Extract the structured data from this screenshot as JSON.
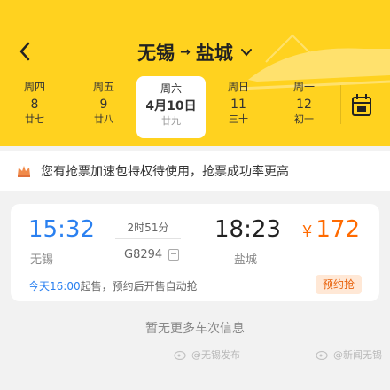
{
  "header": {
    "from": "无锡",
    "to": "盐城",
    "arrow": "→"
  },
  "dates": [
    {
      "weekday": "周四",
      "day": "8",
      "lunar": "廿七"
    },
    {
      "weekday": "周五",
      "day": "9",
      "lunar": "廿八"
    },
    {
      "weekday": "周六",
      "day": "4月10日",
      "lunar": "廿九",
      "selected": true
    },
    {
      "weekday": "周日",
      "day": "11",
      "lunar": "三十"
    },
    {
      "weekday": "周一",
      "day": "12",
      "lunar": "初一"
    }
  ],
  "notice": {
    "text": "您有抢票加速包特权待使用，抢票成功率更高"
  },
  "train": {
    "departure_time": "15:32",
    "arrival_time": "18:23",
    "departure_station": "无锡",
    "arrival_station": "盐城",
    "duration": "2时51分",
    "number": "G8294",
    "currency": "¥",
    "price": "172",
    "sale_time": "今天16:00",
    "sale_text": "起售，预约后开售自动抢",
    "badge": "预约抢"
  },
  "footer": {
    "no_more": "暂无更多车次信息"
  },
  "watermarks": [
    "@无锡发布",
    "@新闻无锡"
  ],
  "colors": {
    "header_bg": "#ffd21f",
    "accent_blue": "#2a80f0",
    "price_orange": "#ff6a00"
  },
  "icons": {
    "back": "back-arrow-icon",
    "dropdown": "chevron-down-icon",
    "calendar": "calendar-icon",
    "crown": "crown-icon",
    "train_info": "train-info-icon"
  }
}
